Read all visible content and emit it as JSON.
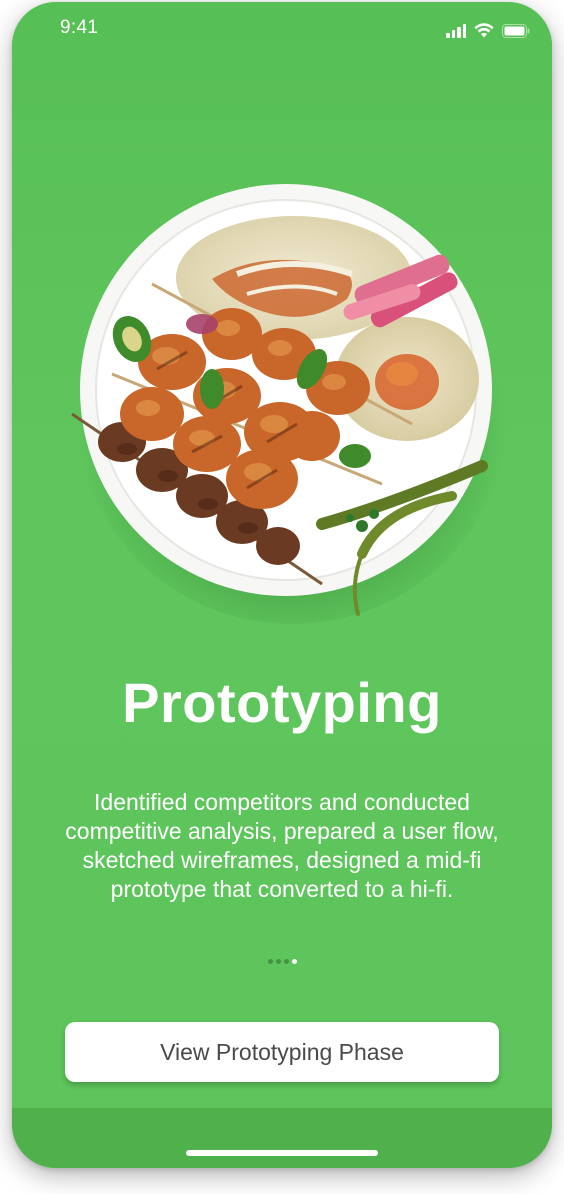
{
  "status_bar": {
    "time": "9:41",
    "icons": [
      "signal-icon",
      "wifi-icon",
      "battery-icon"
    ]
  },
  "hero": {
    "image": "food-plate-kebab-image"
  },
  "content": {
    "title": "Prototyping",
    "description": "Identified competitors and conducted competitive analysis, prepared a user flow, sketched wireframes, designed a mid-fi prototype that converted to a hi-fi."
  },
  "pagination": {
    "total": 4,
    "active_index": 3
  },
  "cta": {
    "label": "View Prototyping Phase"
  },
  "colors": {
    "background": "#5ec45c",
    "bottom_bar": "#4fb04c",
    "button_bg": "#ffffff",
    "button_text": "#4a4a4a",
    "text": "#ffffff"
  }
}
